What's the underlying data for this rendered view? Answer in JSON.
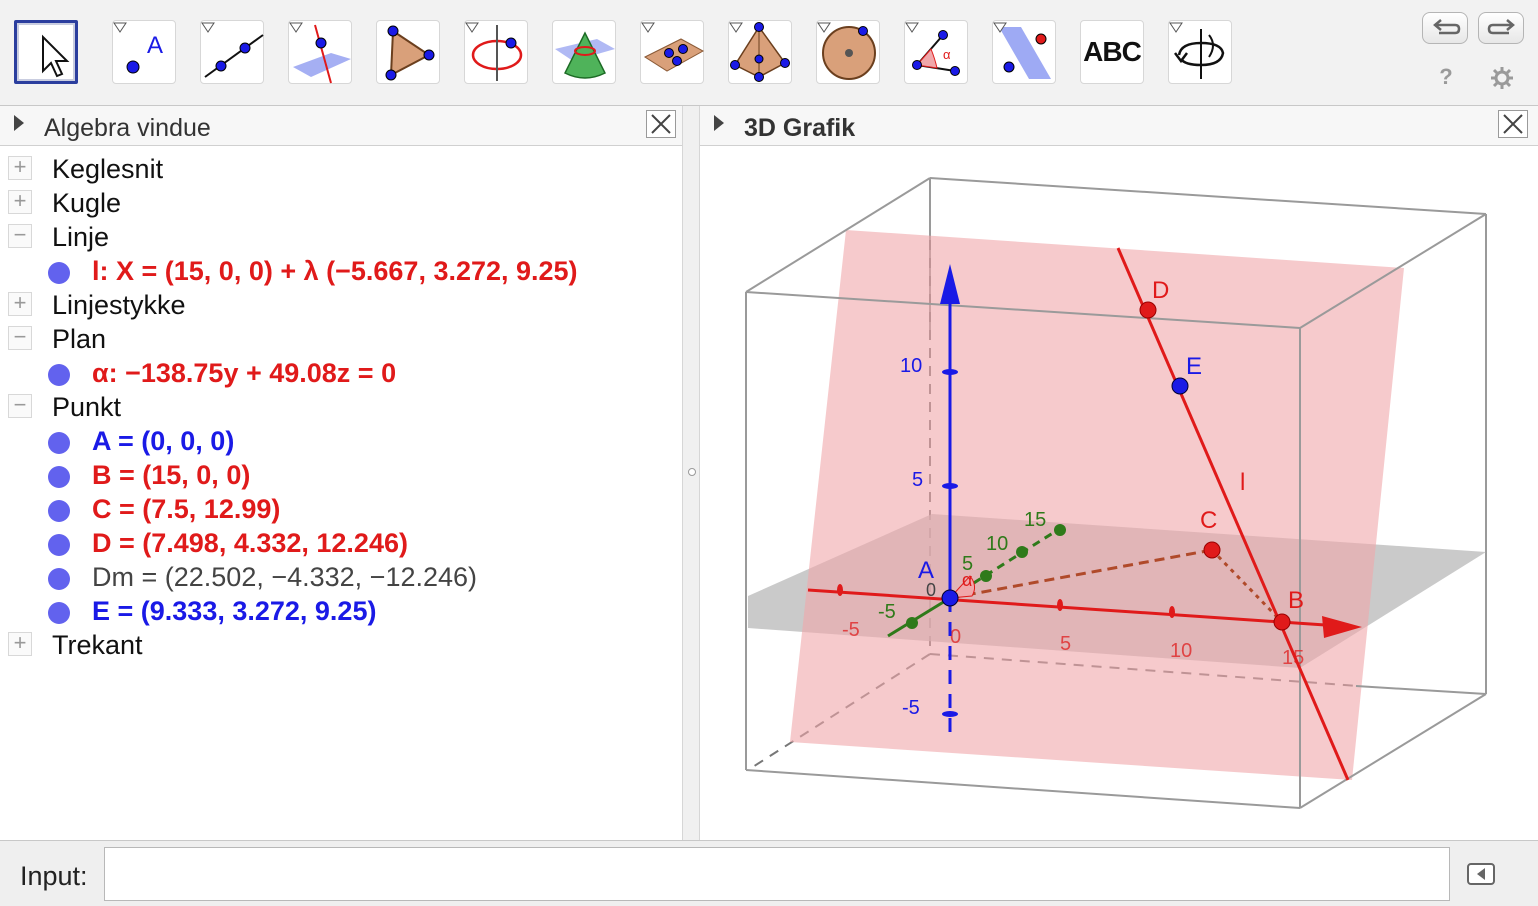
{
  "toolbar": {
    "tools": [
      {
        "name": "move-tool",
        "icon": "arrow-cursor-icon",
        "selected": true
      },
      {
        "name": "point-tool",
        "icon": "point-a-icon",
        "label": "A"
      },
      {
        "name": "line-tool",
        "icon": "line-through-points-icon"
      },
      {
        "name": "perpendicular-tool",
        "icon": "perpendicular-plane-icon"
      },
      {
        "name": "polygon-tool",
        "icon": "triangle-icon"
      },
      {
        "name": "circle-axis-tool",
        "icon": "circle-axis-icon"
      },
      {
        "name": "cone-tool",
        "icon": "cone-intersect-icon"
      },
      {
        "name": "plane-points-tool",
        "icon": "plane-three-points-icon"
      },
      {
        "name": "pyramid-tool",
        "icon": "pyramid-icon"
      },
      {
        "name": "sphere-tool",
        "icon": "sphere-icon"
      },
      {
        "name": "angle-tool",
        "icon": "angle-icon",
        "label": "α"
      },
      {
        "name": "reflect-tool",
        "icon": "reflect-plane-icon"
      },
      {
        "name": "text-tool",
        "icon": "abc-text-icon",
        "label": "ABC"
      },
      {
        "name": "rotate-view-tool",
        "icon": "rotate-view-icon"
      }
    ],
    "undo": "undo-icon",
    "redo": "redo-icon",
    "help": "?",
    "settings": "gear-icon"
  },
  "algebra": {
    "title": "Algebra vindue",
    "rows": [
      {
        "kind": "category",
        "toggle": "+",
        "label": "Keglesnit"
      },
      {
        "kind": "category",
        "toggle": "+",
        "label": "Kugle"
      },
      {
        "kind": "category",
        "toggle": "−",
        "label": "Linje"
      },
      {
        "kind": "object",
        "text": "l: X = (15, 0, 0) + λ (−5.667, 3.272, 9.25)",
        "color": "#e01a1a",
        "bold": true
      },
      {
        "kind": "category",
        "toggle": "+",
        "label": "Linjestykke"
      },
      {
        "kind": "category",
        "toggle": "−",
        "label": "Plan"
      },
      {
        "kind": "object",
        "text": "α: −138.75y + 49.08z = 0",
        "color": "#e01a1a",
        "bold": true
      },
      {
        "kind": "category",
        "toggle": "−",
        "label": "Punkt"
      },
      {
        "kind": "object",
        "text": "A = (0, 0, 0)",
        "color": "#1a1ae6",
        "bold": true
      },
      {
        "kind": "object",
        "text": "B = (15, 0, 0)",
        "color": "#e01a1a",
        "bold": true
      },
      {
        "kind": "object",
        "text": "C = (7.5, 12.99)",
        "color": "#e01a1a",
        "bold": true
      },
      {
        "kind": "object",
        "text": "D = (7.498, 4.332, 12.246)",
        "color": "#e01a1a",
        "bold": true
      },
      {
        "kind": "object",
        "text": "Dm = (22.502, −4.332, −12.246)",
        "color": "#444444",
        "bold": false
      },
      {
        "kind": "object",
        "text": "E = (9.333, 3.272, 9.25)",
        "color": "#1a1ae6",
        "bold": true
      },
      {
        "kind": "category",
        "toggle": "+",
        "label": "Trekant"
      }
    ]
  },
  "graphics": {
    "title": "3D Grafik",
    "labels": {
      "D": "D",
      "E": "E",
      "l": "l",
      "C": "C",
      "A": "A",
      "B": "B",
      "alpha": "α",
      "zTicks": [
        "10",
        "5",
        "-5"
      ],
      "xTicks": [
        "-5",
        "0",
        "5",
        "10",
        "15"
      ],
      "yTicks": [
        "5",
        "10",
        "15",
        "-5"
      ],
      "origin": "0"
    },
    "colors": {
      "xAxis": "#e01a1a",
      "yAxis": "#2f7a1a",
      "zAxis": "#1a1ae6",
      "plane": "#f0a7aa",
      "ground": "#b8b8b8",
      "pointRed": "#e01a1a",
      "pointBlue": "#1a1ae6"
    }
  },
  "input": {
    "label": "Input:",
    "value": "",
    "placeholder": ""
  }
}
